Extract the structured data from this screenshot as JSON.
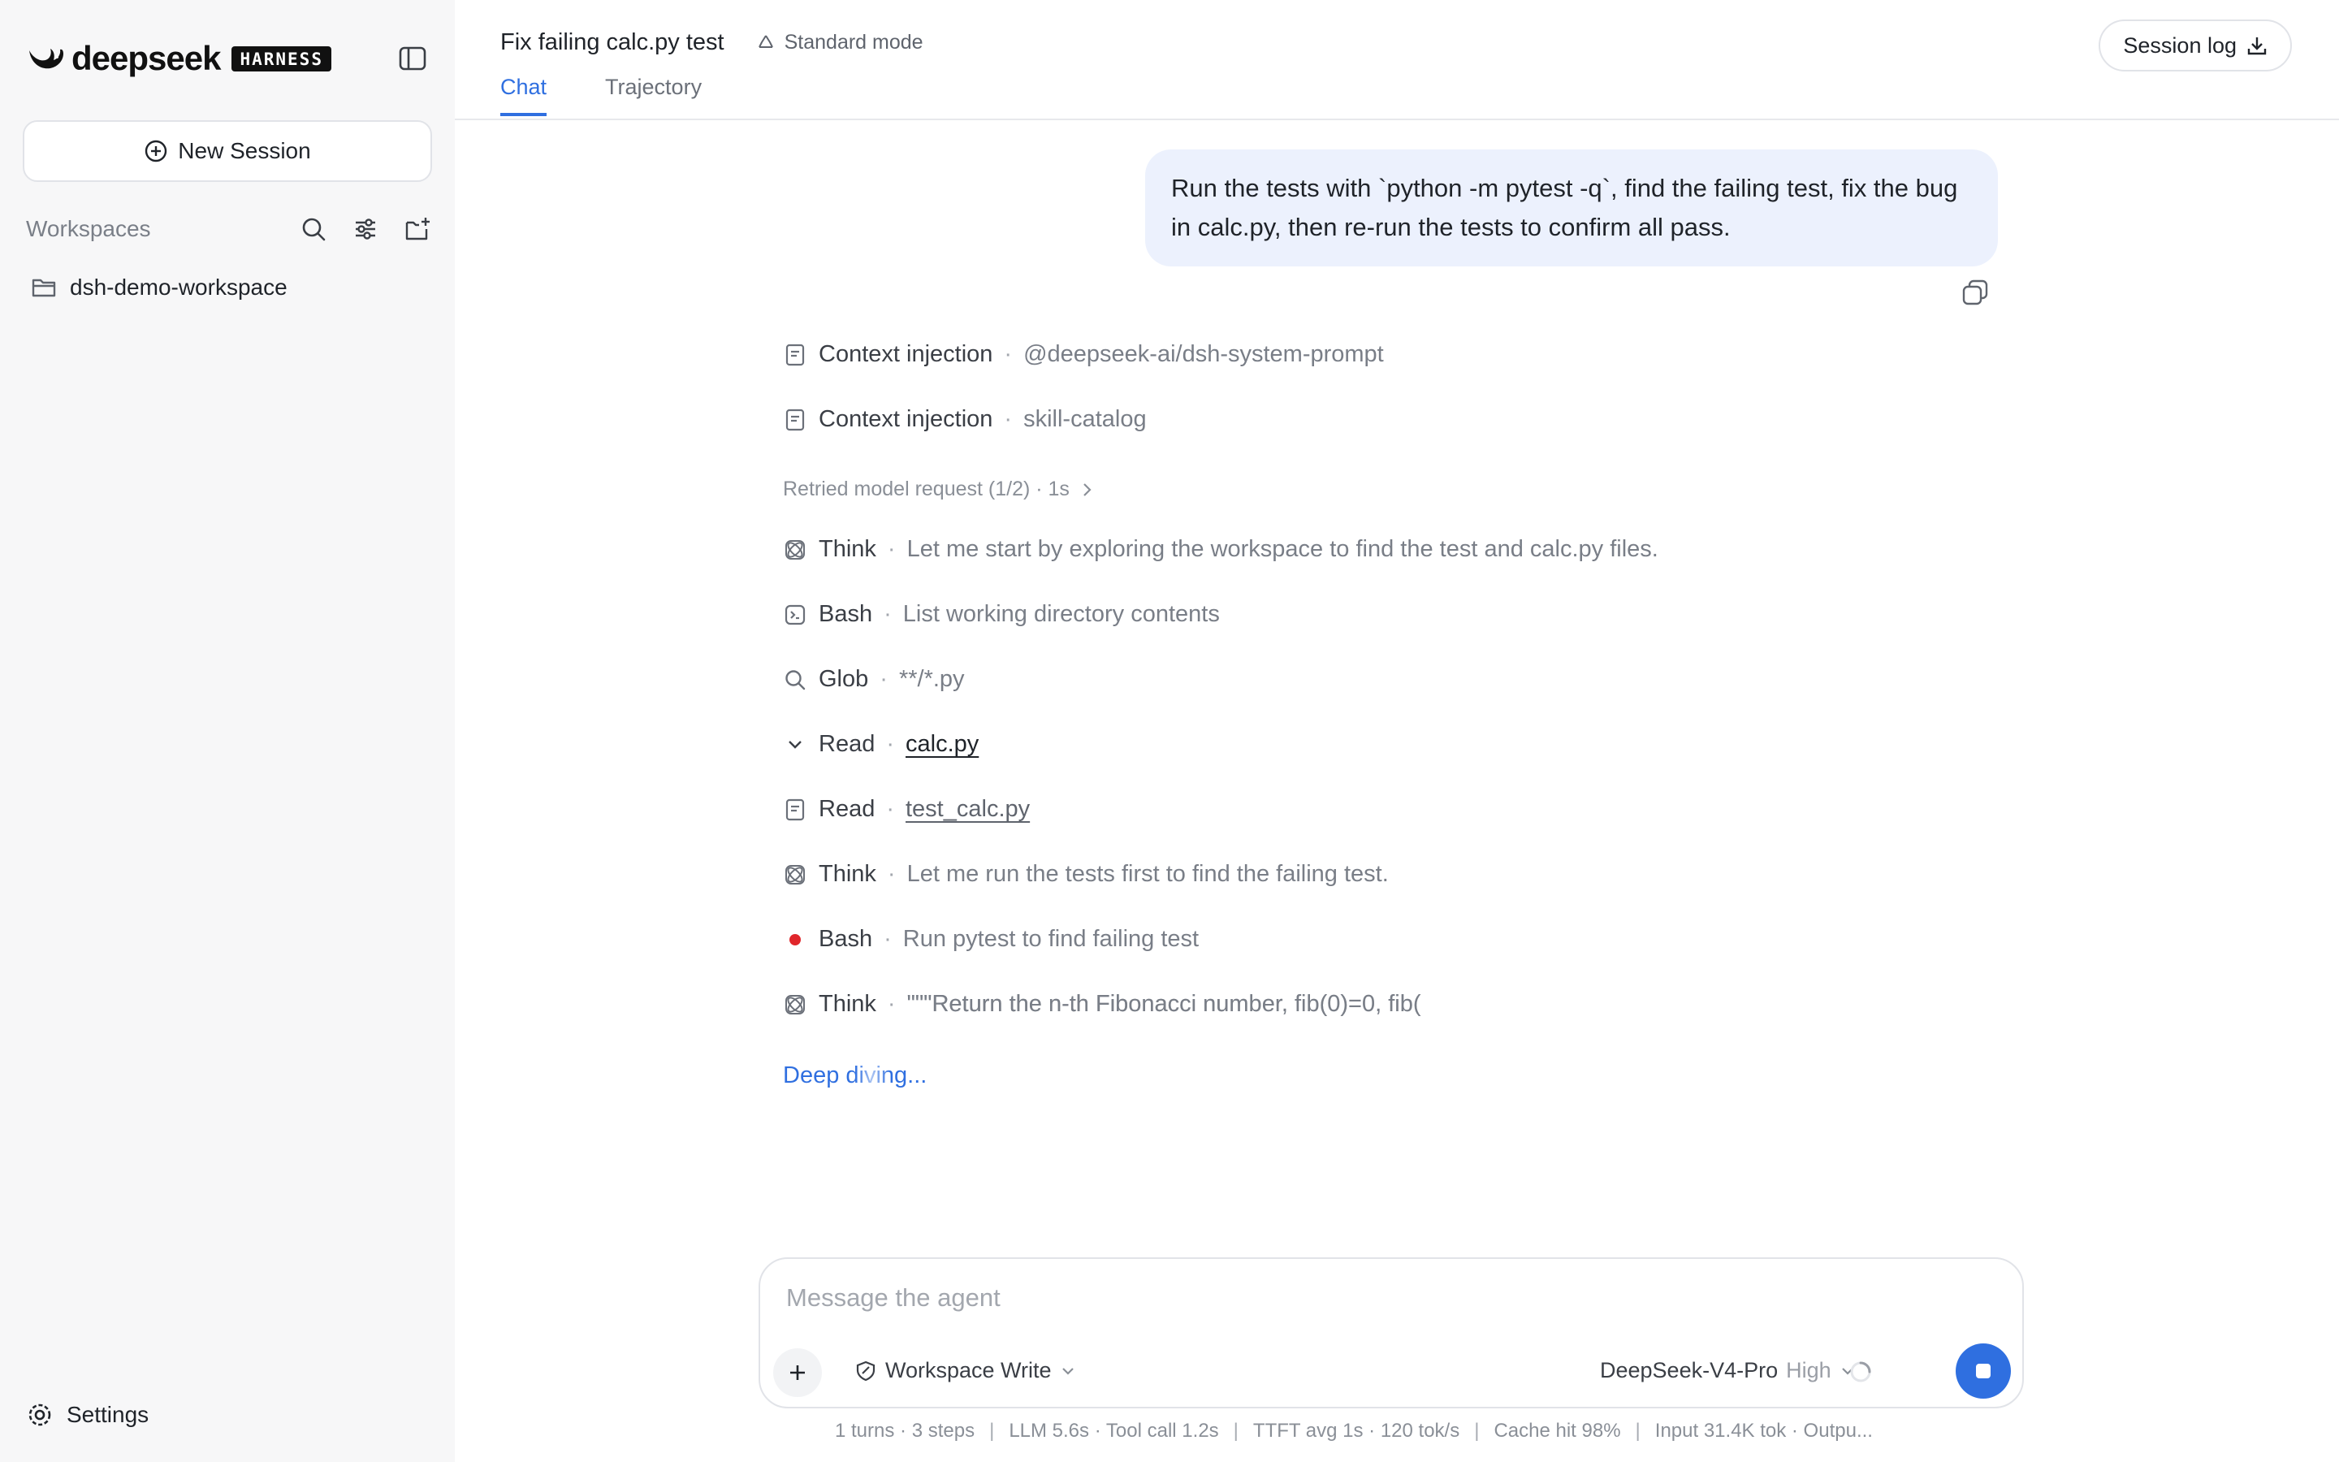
{
  "sidebar": {
    "brand": "deepseek",
    "badge": "HARNESS",
    "new_session_label": "New Session",
    "workspaces_label": "Workspaces",
    "workspace_items": [
      {
        "label": "dsh-demo-workspace"
      }
    ],
    "settings_label": "Settings"
  },
  "header": {
    "title": "Fix failing calc.py test",
    "mode": "Standard mode",
    "tabs": [
      {
        "label": "Chat",
        "active": true
      },
      {
        "label": "Trajectory",
        "active": false
      }
    ],
    "session_log_label": "Session log"
  },
  "chat": {
    "user_message": "Run the tests with `python -m pytest -q`, find the failing test, fix the bug in calc.py, then re-run the tests to confirm all pass.",
    "separator": "·",
    "steps": [
      {
        "icon": "document-icon",
        "name": "Context injection",
        "detail": "@deepseek-ai/dsh-system-prompt"
      },
      {
        "icon": "document-icon",
        "name": "Context injection",
        "detail": "skill-catalog"
      },
      {
        "retry": "Retried model request (1/2) · 1s"
      },
      {
        "icon": "atom-icon",
        "name": "Think",
        "detail": "Let me start by exploring the workspace to find the test and calc.py files."
      },
      {
        "icon": "terminal-icon",
        "name": "Bash",
        "detail": "List working directory contents"
      },
      {
        "icon": "search-icon",
        "name": "Glob",
        "detail": "**/*.py"
      },
      {
        "icon": "chevron-down-icon",
        "name": "Read",
        "detail": "calc.py"
      },
      {
        "icon": "document-icon",
        "name": "Read",
        "detail": "test_calc.py"
      },
      {
        "icon": "atom-icon",
        "name": "Think",
        "detail": "Let me run the tests first to find the failing test."
      },
      {
        "icon": "running-dot-icon",
        "name": "Bash",
        "detail": "Run pytest to find failing test"
      },
      {
        "icon": "atom-icon",
        "name": "Think",
        "detail": "\"\"\"Return the n-th Fibonacci number, fib(0)=0, fib("
      }
    ],
    "status": "Deep diving..."
  },
  "composer": {
    "placeholder": "Message the agent",
    "permission": "Workspace Write",
    "model": "DeepSeek-V4-Pro",
    "effort": "High"
  },
  "stats": {
    "turns": "1 turns · 3 steps",
    "llm": "LLM 5.6s · Tool call 1.2s",
    "ttft": "TTFT avg 1s · 120 tok/s",
    "cache": "Cache hit 98%",
    "tokens": "Input 31.4K tok · Outpu...",
    "separator": "|"
  },
  "colors": {
    "accent": "#2f6fe0",
    "bubble": "#ecf1fd",
    "sidebar": "#f7f7f8",
    "running": "#e0262b"
  }
}
